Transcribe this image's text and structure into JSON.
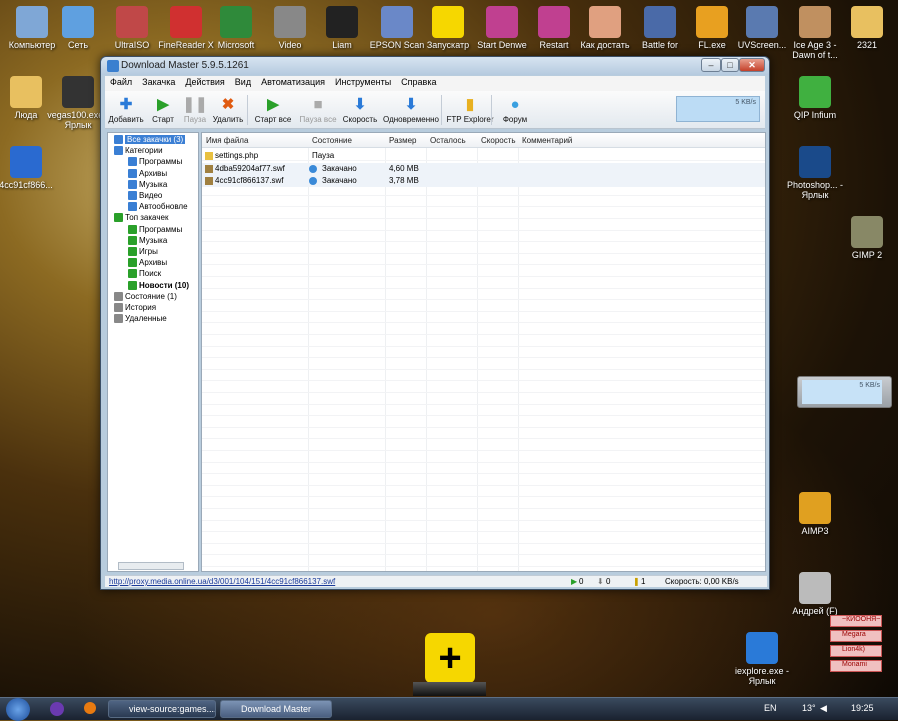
{
  "desktop_icons": [
    {
      "label": "Компьютер",
      "icon": "computer-icon",
      "color": "#7fa7d6"
    },
    {
      "label": "Сеть",
      "icon": "network-icon",
      "color": "#5fa0e0"
    },
    {
      "label": "UltraISO",
      "icon": "disc-icon",
      "color": "#c04848"
    },
    {
      "label": "FineReader X",
      "icon": "finereader-icon",
      "color": "#d03030"
    },
    {
      "label": "Microsoft",
      "icon": "excel-icon",
      "color": "#2f8a3a"
    },
    {
      "label": "Video",
      "icon": "film-reel-icon",
      "color": "#888888"
    },
    {
      "label": "Liam",
      "icon": "folder-icon",
      "color": "#222222"
    },
    {
      "label": "EPSON Scan",
      "icon": "scanner-icon",
      "color": "#6a88c8"
    },
    {
      "label": "Запускатр",
      "icon": "plus-icon",
      "color": "#f6d700"
    },
    {
      "label": "Start Denwe",
      "icon": "denwer-icon",
      "color": "#c04090"
    },
    {
      "label": "Restart",
      "icon": "restart-icon",
      "color": "#c04090"
    },
    {
      "label": "Как достать",
      "icon": "anime-icon",
      "color": "#e0a080"
    },
    {
      "label": "Battle for",
      "icon": "game-icon",
      "color": "#4a6aa8"
    },
    {
      "label": "FL.exe",
      "icon": "fl-studio-icon",
      "color": "#e8a020"
    },
    {
      "label": "UVScreen...",
      "icon": "uvscreen-icon",
      "color": "#5a7ab0"
    },
    {
      "label": "Ice Age 3 - Dawn of t...",
      "icon": "ice-age-icon",
      "color": "#c09060"
    },
    {
      "label": "2321",
      "icon": "folder-icon",
      "color": "#e8c060"
    },
    {
      "label": "Люда",
      "icon": "folder-icon",
      "color": "#e8c060"
    },
    {
      "label": "vegas100.exe - Ярлык",
      "icon": "vegas-icon",
      "color": "#333333"
    },
    {
      "label": "4cc91cf866...",
      "icon": "swf-file-icon",
      "color": "#2a6ad0"
    },
    {
      "label": "QIP Infium",
      "icon": "qip-icon",
      "color": "#40b040"
    },
    {
      "label": "Photoshop... - Ярлык",
      "icon": "photoshop-icon",
      "color": "#1a4a8a"
    },
    {
      "label": "GIMP 2",
      "icon": "gimp-icon",
      "color": "#888866"
    },
    {
      "label": "AIMP3",
      "icon": "aimp-icon",
      "color": "#e0a020"
    },
    {
      "label": "Андрей (F)",
      "icon": "drive-icon",
      "color": "#bbbbbb"
    },
    {
      "label": "iexplore.exe - Ярлык",
      "icon": "ie-icon",
      "color": "#2a7ad8"
    }
  ],
  "window": {
    "title": "Download Master 5.9.5.1261",
    "minimize": "–",
    "maximize": "□",
    "close": "✕"
  },
  "menu": [
    "Файл",
    "Закачка",
    "Действия",
    "Вид",
    "Автоматизация",
    "Инструменты",
    "Справка"
  ],
  "toolbar": [
    {
      "label": "Добавить",
      "icon": "add-icon",
      "glyph": "✚",
      "color": "#2a7ad8",
      "enabled": true
    },
    {
      "label": "Старт",
      "icon": "play-icon",
      "glyph": "▶",
      "color": "#2aa02a",
      "enabled": true
    },
    {
      "label": "Пауза",
      "icon": "pause-icon",
      "glyph": "❚❚",
      "color": "#aaaaaa",
      "enabled": false
    },
    {
      "label": "Удалить",
      "icon": "delete-icon",
      "glyph": "✖",
      "color": "#e05a10",
      "enabled": true
    },
    {
      "label": "Старт все",
      "icon": "start-all-icon",
      "glyph": "▶",
      "color": "#2aa02a",
      "enabled": true
    },
    {
      "label": "Пауза все",
      "icon": "pause-all-icon",
      "glyph": "■",
      "color": "#aaaaaa",
      "enabled": false
    },
    {
      "label": "Скорость",
      "icon": "speed-icon",
      "glyph": "⬇",
      "color": "#2a7ad8",
      "enabled": true
    },
    {
      "label": "Одновременно",
      "icon": "simultaneous-icon",
      "glyph": "⬇",
      "color": "#2a7ad8",
      "enabled": true
    },
    {
      "label": "FTP Explorer",
      "icon": "ftp-folder-icon",
      "glyph": "▮",
      "color": "#e8b020",
      "enabled": true
    },
    {
      "label": "Форум",
      "icon": "forum-icon",
      "glyph": "●",
      "color": "#3aa0e0",
      "enabled": true
    }
  ],
  "speed_box": "5 KB/s",
  "tree": [
    {
      "label": "Все закачки (3)",
      "level": 1,
      "selected": true,
      "color": "#3a7fd4"
    },
    {
      "label": "Категории",
      "level": 1,
      "color": "#3a7fd4"
    },
    {
      "label": "Программы",
      "level": 2,
      "color": "#3a7fd4"
    },
    {
      "label": "Архивы",
      "level": 2,
      "color": "#3a7fd4"
    },
    {
      "label": "Музыка",
      "level": 2,
      "color": "#3a7fd4"
    },
    {
      "label": "Видео",
      "level": 2,
      "color": "#3a7fd4"
    },
    {
      "label": "Автообновле",
      "level": 2,
      "color": "#3a7fd4"
    },
    {
      "label": "Топ закачек",
      "level": 1,
      "color": "#2aa02a"
    },
    {
      "label": "Программы",
      "level": 2,
      "color": "#2aa02a"
    },
    {
      "label": "Музыка",
      "level": 2,
      "color": "#2aa02a"
    },
    {
      "label": "Игры",
      "level": 2,
      "color": "#2aa02a"
    },
    {
      "label": "Архивы",
      "level": 2,
      "color": "#2aa02a"
    },
    {
      "label": "Поиск",
      "level": 2,
      "color": "#2aa02a"
    },
    {
      "label": "Новости (10)",
      "level": 2,
      "bold": true,
      "color": "#2aa02a"
    },
    {
      "label": "Состояние (1)",
      "level": 1,
      "color": "#888888"
    },
    {
      "label": "История",
      "level": 1,
      "color": "#888888"
    },
    {
      "label": "Удаленные",
      "level": 1,
      "color": "#888888"
    }
  ],
  "columns": [
    "Имя файла",
    "Состояние",
    "Размер",
    "Осталось",
    "Скорость",
    "Комментарий"
  ],
  "rows": [
    {
      "name": "settings.php",
      "status": "Пауза",
      "size": "",
      "icon": "folder-icon",
      "status_icon": ""
    },
    {
      "name": "4dba59204af77.swf",
      "status": "Закачано",
      "size": "4,60 MB",
      "icon": "file-icon",
      "status_icon": "done-icon"
    },
    {
      "name": "4cc91cf866137.swf",
      "status": "Закачано",
      "size": "3,78 MB",
      "icon": "file-icon",
      "status_icon": "done-icon"
    }
  ],
  "status": {
    "url": "http://proxy.media.online.ua/d3/001/104/151/4cc91cf866137.swf",
    "active": "0",
    "downloading": "0",
    "paused": "1",
    "speed": "Скорость: 0,00 KB/s"
  },
  "gadget_speed": "5 KB/s",
  "contacts": [
    "~КИООНЯ~",
    "Megara",
    "Lion4k)",
    "Monami"
  ],
  "taskbar": {
    "items": [
      "view-source:games....",
      "Download Master"
    ],
    "lang": "EN",
    "temp": "13°",
    "time": "19:25"
  }
}
